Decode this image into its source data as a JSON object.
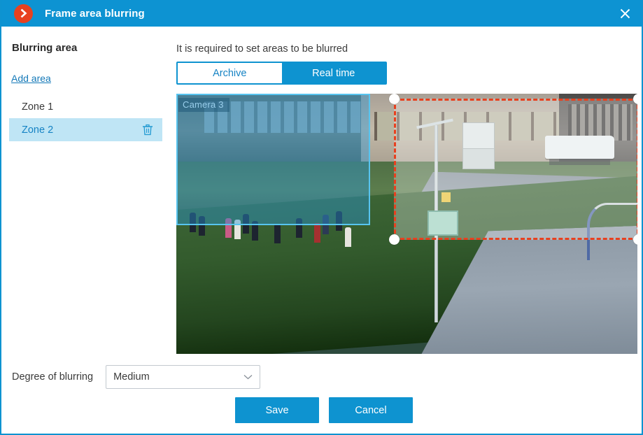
{
  "window": {
    "title": "Frame area blurring",
    "logo_icon": "chevron-right-circle-icon",
    "close_icon": "close-icon",
    "accent_color": "#0d93d2",
    "logo_color": "#e8411f"
  },
  "sidebar": {
    "heading": "Blurring area",
    "add_area_label": "Add area",
    "zones": [
      {
        "label": "Zone 1",
        "selected": false,
        "has_delete": false
      },
      {
        "label": "Zone 2",
        "selected": true,
        "has_delete": true,
        "delete_icon": "trash-icon"
      }
    ]
  },
  "degree": {
    "label": "Degree of blurring",
    "value": "Medium",
    "chevron_icon": "chevron-down-icon"
  },
  "main": {
    "hint": "It is required to set areas to be blurred",
    "tabs": [
      {
        "label": "Archive",
        "active": false
      },
      {
        "label": "Real time",
        "active": true
      }
    ],
    "video": {
      "camera_label": "Camera 3",
      "regions": [
        {
          "name": "Zone 1",
          "style": "solid",
          "color": "#57c4ef",
          "selected": false
        },
        {
          "name": "Zone 2",
          "style": "dashed",
          "color": "#e8401f",
          "selected": true,
          "handles": 4
        }
      ]
    }
  },
  "footer": {
    "save_label": "Save",
    "cancel_label": "Cancel"
  }
}
